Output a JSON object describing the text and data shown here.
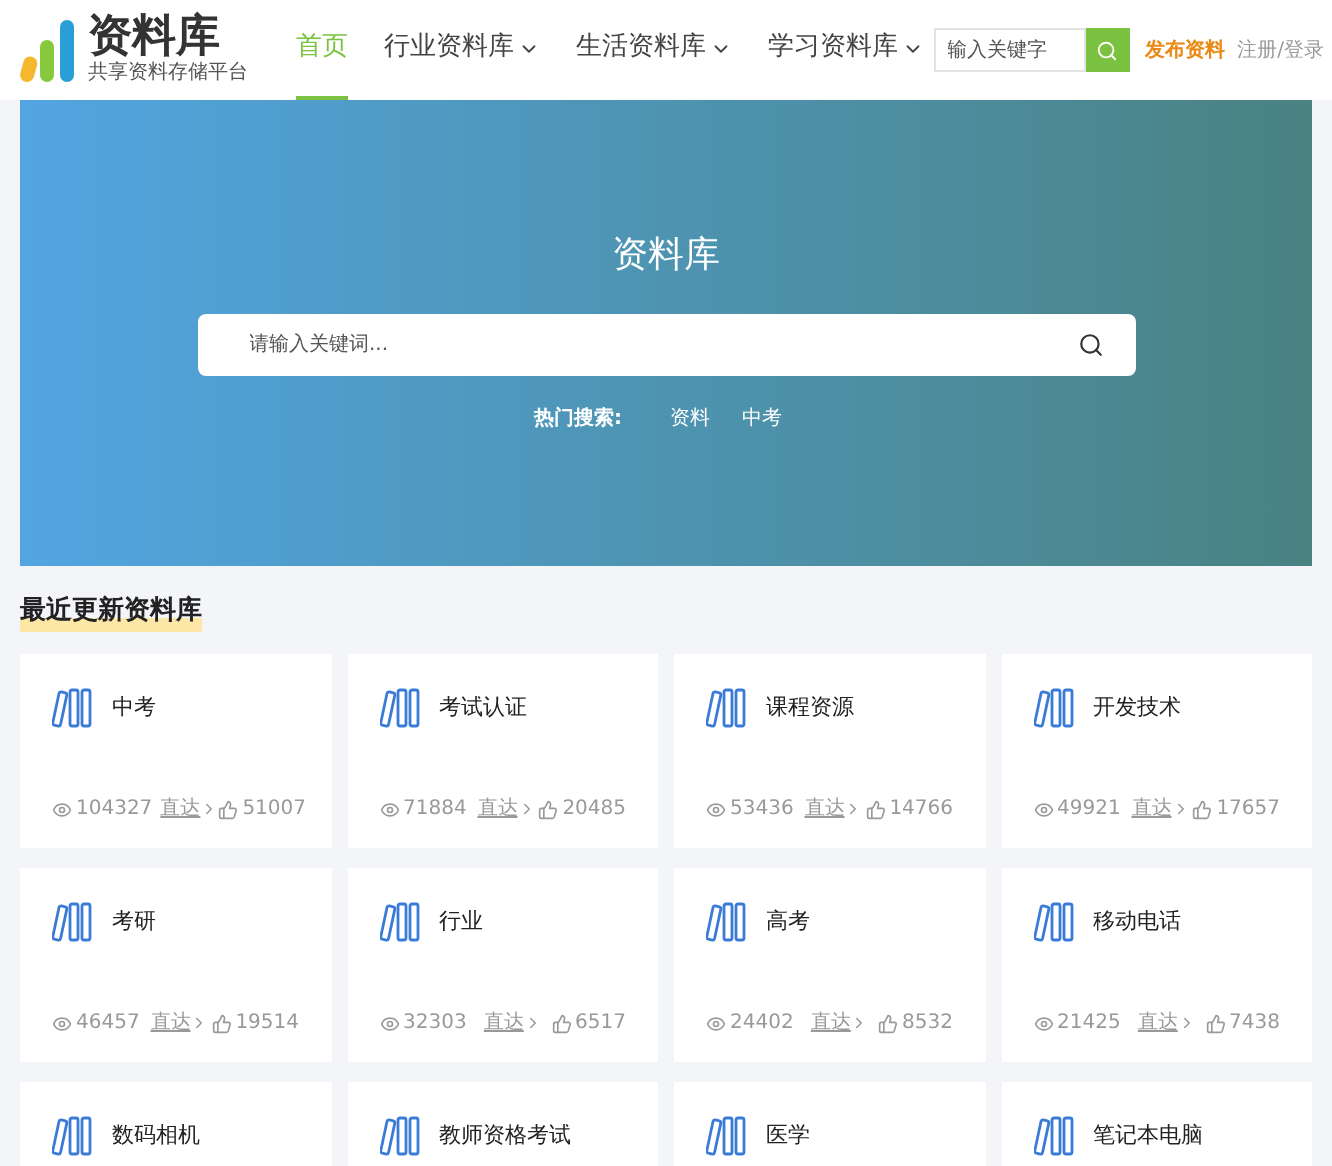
{
  "logo": {
    "title": "资料库",
    "tagline": "共享资料存储平台"
  },
  "nav": [
    {
      "label": "首页",
      "selected": true,
      "dropdown": false
    },
    {
      "label": "行业资料库",
      "selected": false,
      "dropdown": true
    },
    {
      "label": "生活资料库",
      "selected": false,
      "dropdown": true
    },
    {
      "label": "学习资料库",
      "selected": false,
      "dropdown": true
    }
  ],
  "header_search": {
    "placeholder": "输入关键字"
  },
  "publish_link": "发布资料",
  "auth_link": "注册/登录",
  "hero": {
    "title": "资料库",
    "search_placeholder": "请输入关键词...",
    "hot_label": "热门搜索:",
    "hot_terms": [
      "资料",
      "中考"
    ]
  },
  "section_title": "最近更新资料库",
  "cards": [
    {
      "name": "中考",
      "views": "104327",
      "link": "直达",
      "likes": "51007"
    },
    {
      "name": "考试认证",
      "views": "71884",
      "link": "直达",
      "likes": "20485"
    },
    {
      "name": "课程资源",
      "views": "53436",
      "link": "直达",
      "likes": "14766"
    },
    {
      "name": "开发技术",
      "views": "49921",
      "link": "直达",
      "likes": "17657"
    },
    {
      "name": "考研",
      "views": "46457",
      "link": "直达",
      "likes": "19514"
    },
    {
      "name": "行业",
      "views": "32303",
      "link": "直达",
      "likes": "6517"
    },
    {
      "name": "高考",
      "views": "24402",
      "link": "直达",
      "likes": "8532"
    },
    {
      "name": "移动电话",
      "views": "21425",
      "link": "直达",
      "likes": "7438"
    },
    {
      "name": "数码相机"
    },
    {
      "name": "教师资格考试"
    },
    {
      "name": "医学"
    },
    {
      "name": "笔记本电脑"
    }
  ]
}
